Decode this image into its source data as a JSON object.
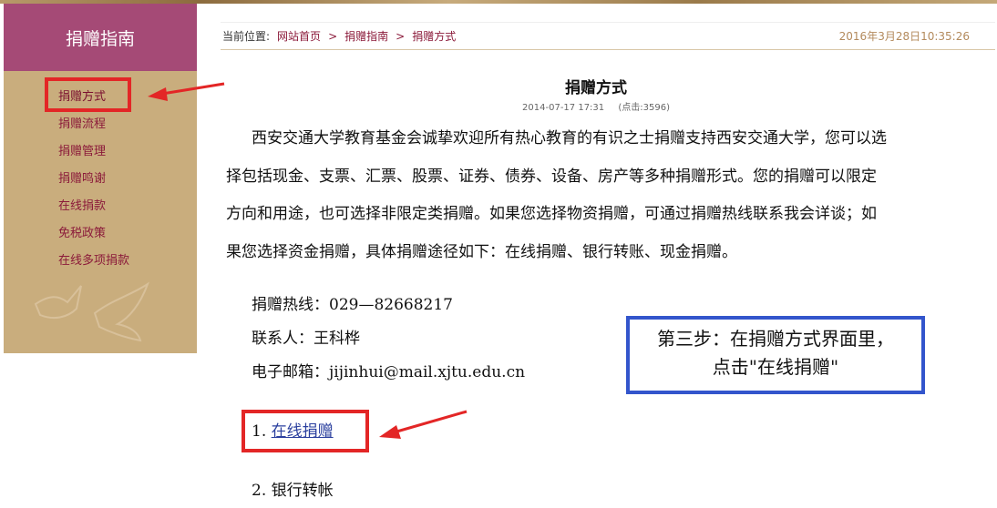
{
  "sidebar": {
    "title": "捐赠指南",
    "items": [
      {
        "label": "捐赠方式"
      },
      {
        "label": "捐赠流程"
      },
      {
        "label": "捐赠管理"
      },
      {
        "label": "捐赠鸣谢"
      },
      {
        "label": "在线捐款"
      },
      {
        "label": "免税政策"
      },
      {
        "label": "在线多项捐款"
      }
    ]
  },
  "breadcrumb": {
    "prefix": "当前位置:",
    "links": [
      "网站首页",
      "捐赠指南",
      "捐赠方式"
    ],
    "separator": ">",
    "datetime": "2016年3月28日10:35:26"
  },
  "article": {
    "title": "捐赠方式",
    "date": "2014-07-17 17:31",
    "views": "(点击:3596)",
    "paragraph_lines": [
      "西安交通大学教育基金会诚挚欢迎所有热心教育的有识之士捐赠支持西安交通大学，您可以选",
      "择包括现金、支票、汇票、股票、证券、债券、设备、房产等多种捐赠形式。您的捐赠可以限定",
      "方向和用途，也可选择非限定类捐赠。如果您选择物资捐赠，可通过捐赠热线联系我会详谈；如",
      "果您选择资金捐赠，具体捐赠途径如下：在线捐赠、银行转账、现金捐赠。"
    ],
    "hotline": "捐赠热线：029—82668217",
    "contact_person": "联系人：王科桦",
    "email": "电子邮箱：jijinhui@mail.xjtu.edu.cn",
    "option1_num": "1.",
    "option1_link": "在线捐赠",
    "option2": "2. 银行转帐"
  },
  "annotation": {
    "callout_line1": "第三步：在捐赠方式界面里，",
    "callout_line2": "点击\"在线捐赠\""
  },
  "colors": {
    "sidebar_header": "#a54a76",
    "sidebar_bg": "#c9ad7d",
    "highlight_red": "#e32626",
    "callout_blue": "#3355cc",
    "link_blue": "#2a3f9e"
  }
}
